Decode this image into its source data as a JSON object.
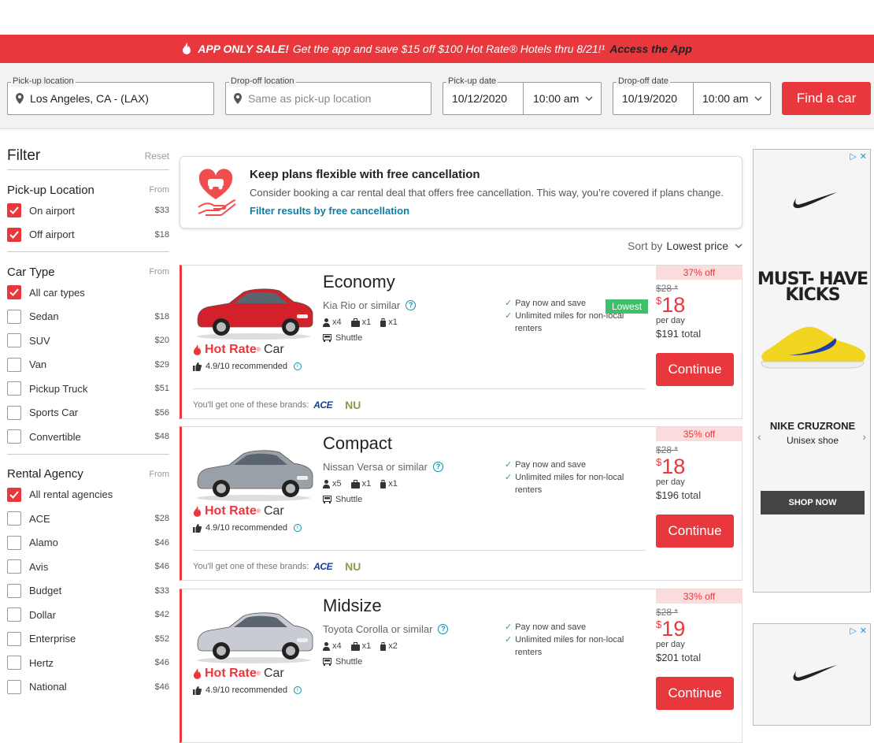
{
  "promo": {
    "bold": "APP ONLY SALE!",
    "text": "Get the app and save $15 off $100 Hot Rate® Hotels thru 8/21!¹",
    "link": "Access the App"
  },
  "search": {
    "pickup_label": "Pick-up location",
    "pickup_value": "Los Angeles, CA - (LAX)",
    "dropoff_label": "Drop-off location",
    "dropoff_placeholder": "Same as pick-up location",
    "pickup_date_label": "Pick-up date",
    "pickup_date": "10/12/2020",
    "pickup_time": "10:00 am",
    "dropoff_date_label": "Drop-off date",
    "dropoff_date": "10/19/2020",
    "dropoff_time": "10:00 am",
    "find_label": "Find a car"
  },
  "filter": {
    "title": "Filter",
    "reset": "Reset",
    "from": "From",
    "pickup_location": {
      "title": "Pick-up Location",
      "items": [
        {
          "name": "On airport",
          "price": "$33",
          "checked": true
        },
        {
          "name": "Off airport",
          "price": "$18",
          "checked": true
        }
      ]
    },
    "car_type": {
      "title": "Car Type",
      "items": [
        {
          "name": "All car types",
          "price": "",
          "checked": true
        },
        {
          "name": "Sedan",
          "price": "$18",
          "checked": false
        },
        {
          "name": "SUV",
          "price": "$20",
          "checked": false
        },
        {
          "name": "Van",
          "price": "$29",
          "checked": false
        },
        {
          "name": "Pickup Truck",
          "price": "$51",
          "checked": false
        },
        {
          "name": "Sports Car",
          "price": "$56",
          "checked": false
        },
        {
          "name": "Convertible",
          "price": "$48",
          "checked": false
        }
      ]
    },
    "agency": {
      "title": "Rental Agency",
      "items": [
        {
          "name": "All rental agencies",
          "price": "",
          "checked": true
        },
        {
          "name": "ACE",
          "price": "$28",
          "checked": false
        },
        {
          "name": "Alamo",
          "price": "$46",
          "checked": false
        },
        {
          "name": "Avis",
          "price": "$46",
          "checked": false
        },
        {
          "name": "Budget",
          "price": "$33",
          "checked": false
        },
        {
          "name": "Dollar",
          "price": "$42",
          "checked": false
        },
        {
          "name": "Enterprise",
          "price": "$52",
          "checked": false
        },
        {
          "name": "Hertz",
          "price": "$46",
          "checked": false
        },
        {
          "name": "National",
          "price": "$46",
          "checked": false
        }
      ]
    }
  },
  "notice": {
    "heading": "Keep plans flexible with free cancellation",
    "desc": "Consider booking a car rental deal that offers free cancellation. This way, you’re covered if plans change.",
    "link": "Filter results by free cancellation"
  },
  "sort": {
    "label": "Sort by",
    "value": "Lowest price"
  },
  "cars": [
    {
      "class": "Economy",
      "model": "Kia Rio or similar",
      "people": "x4",
      "bags": "x1",
      "small_bags": "x1",
      "shuttle": "Shuttle",
      "hot": "Hot Rate",
      "car_word": "Car",
      "rec": "4.9/10 recommended",
      "perk1": "Pay now and save",
      "perk2": "Unlimited miles for non-local",
      "perk3": "renters",
      "lowest": "Lowest",
      "brands": "You'll get one of these brands:",
      "off": "37% off",
      "old": "$28 *",
      "price": "18",
      "per": "per day",
      "total": "$191",
      "total_word": "total",
      "cta": "Continue",
      "color": "#d4202a"
    },
    {
      "class": "Compact",
      "model": "Nissan Versa or similar",
      "people": "x5",
      "bags": "x1",
      "small_bags": "x1",
      "shuttle": "Shuttle",
      "hot": "Hot Rate",
      "car_word": "Car",
      "rec": "4.9/10 recommended",
      "perk1": "Pay now and save",
      "perk2": "Unlimited miles for non-local",
      "perk3": "renters",
      "brands": "You'll get one of these brands:",
      "off": "35% off",
      "old": "$28 *",
      "price": "18",
      "per": "per day",
      "total": "$196",
      "total_word": "total",
      "cta": "Continue",
      "color": "#9aa0a8"
    },
    {
      "class": "Midsize",
      "model": "Toyota Corolla or similar",
      "people": "x4",
      "bags": "x1",
      "small_bags": "x2",
      "shuttle": "Shuttle",
      "hot": "Hot Rate",
      "car_word": "Car",
      "rec": "4.9/10 recommended",
      "perk1": "Pay now and save",
      "perk2": "Unlimited miles for non-local",
      "perk3": "renters",
      "off": "33% off",
      "old": "$28 *",
      "price": "19",
      "per": "per day",
      "total": "$201",
      "total_word": "total",
      "cta": "Continue",
      "color": "#c8ccd2"
    }
  ],
  "ad": {
    "headline": "MUST- HAVE KICKS",
    "product": "NIKE CRUZRONE",
    "sub": "Unisex shoe",
    "cta": "SHOP NOW"
  },
  "brand_logos": {
    "ace": "ACE",
    "nu": "NU"
  },
  "currency": "$",
  "colors": {
    "accent": "#e8383d",
    "link": "#0a7ea8",
    "success": "#3fbf6a"
  }
}
